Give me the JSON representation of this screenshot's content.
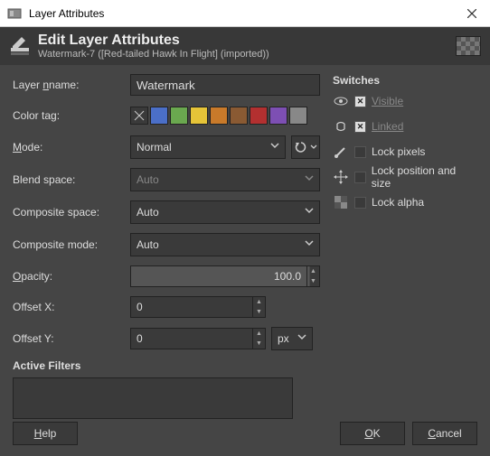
{
  "titlebar": {
    "title": "Layer Attributes"
  },
  "header": {
    "title": "Edit Layer Attributes",
    "subtitle": "Watermark-7 ([Red-tailed Hawk In Flight] (imported))"
  },
  "labels": {
    "layer_name": "name:",
    "color_tag": "Color tag:",
    "mode": "ode:",
    "blend_space": "Blend space:",
    "composite_space": "Composite space:",
    "composite_mode": "Composite mode:",
    "opacity": "pacity:",
    "offset_x": "Offset X:",
    "offset_y": "Offset Y:",
    "active_filters": "Active Filters"
  },
  "values": {
    "layer_name": "Watermark",
    "mode": "Normal",
    "blend_space": "Auto",
    "composite_space": "Auto",
    "composite_mode": "Auto",
    "opacity": "100.0",
    "offset_x": "0",
    "offset_y": "0",
    "unit": "px"
  },
  "switches": {
    "title": "Switches",
    "items": [
      {
        "icon": "eye",
        "checked": true,
        "label": "Visible",
        "dim": true
      },
      {
        "icon": "link",
        "checked": true,
        "label": "Linked",
        "dim": true
      },
      {
        "icon": "brush",
        "checked": false,
        "label": "Lock pixels",
        "dim": false
      },
      {
        "icon": "move",
        "checked": false,
        "label": "Lock position and size",
        "dim": false
      },
      {
        "icon": "checker",
        "checked": false,
        "label": "Lock alpha",
        "dim": false
      }
    ]
  },
  "buttons": {
    "help": "elp",
    "ok": "K",
    "cancel": "ancel"
  }
}
